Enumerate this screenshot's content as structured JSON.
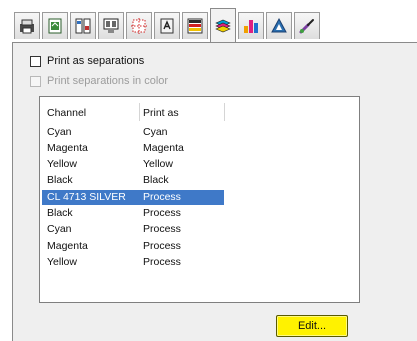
{
  "tabs": [
    {
      "icon": "printer-icon"
    },
    {
      "icon": "page-setup-icon"
    },
    {
      "icon": "layout-icon"
    },
    {
      "icon": "imposition-icon"
    },
    {
      "icon": "marks-icon"
    },
    {
      "icon": "fonts-icon"
    },
    {
      "icon": "color-bars-icon"
    },
    {
      "icon": "separations-icon"
    },
    {
      "icon": "prepress-icon"
    },
    {
      "icon": "postscript-icon"
    },
    {
      "icon": "brush-icon"
    }
  ],
  "active_tab": "separations-icon",
  "options": {
    "print_as_separations": {
      "label": "Print as separations",
      "checked": false
    },
    "print_separations_in_color": {
      "label": "Print separations in color",
      "checked": false,
      "disabled": true
    }
  },
  "list": {
    "columns": [
      "Channel",
      "Print as"
    ],
    "rows": [
      {
        "channel": "Cyan",
        "print_as": "Cyan"
      },
      {
        "channel": "Magenta",
        "print_as": "Magenta"
      },
      {
        "channel": "Yellow",
        "print_as": "Yellow"
      },
      {
        "channel": "Black",
        "print_as": "Black"
      },
      {
        "channel": "CL 4713 SILVER",
        "print_as": "Process",
        "selected": true
      },
      {
        "channel": "Black",
        "print_as": "Process"
      },
      {
        "channel": "Cyan",
        "print_as": "Process"
      },
      {
        "channel": "Magenta",
        "print_as": "Process"
      },
      {
        "channel": "Yellow",
        "print_as": "Process"
      }
    ]
  },
  "edit_button": {
    "label": "Edit..."
  },
  "colors": {
    "selection": "#3f79c8",
    "edit_button": "#fff200"
  }
}
